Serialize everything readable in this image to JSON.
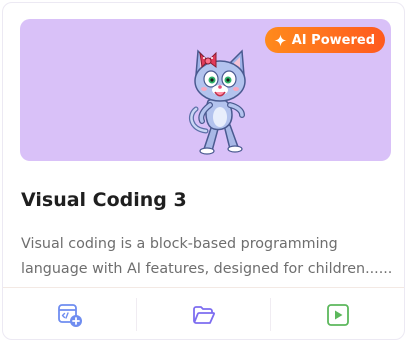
{
  "card": {
    "badge_label": "AI Powered",
    "title": "Visual Coding 3",
    "description_line1": "Visual coding is a block-based programming",
    "description_line2": "language with AI features, designed for children......"
  },
  "colors": {
    "banner_bg": "#d9c1f8",
    "badge_gradient_start": "#ff8a1c",
    "badge_gradient_end": "#ff5a1f",
    "new_project_icon": "#6f8df0",
    "open_folder_icon": "#7d6df0",
    "run_icon": "#5cb85c"
  },
  "icons": {
    "badge": "sparkle-icon",
    "actions": [
      "new-project-icon",
      "open-folder-icon",
      "play-icon"
    ]
  }
}
